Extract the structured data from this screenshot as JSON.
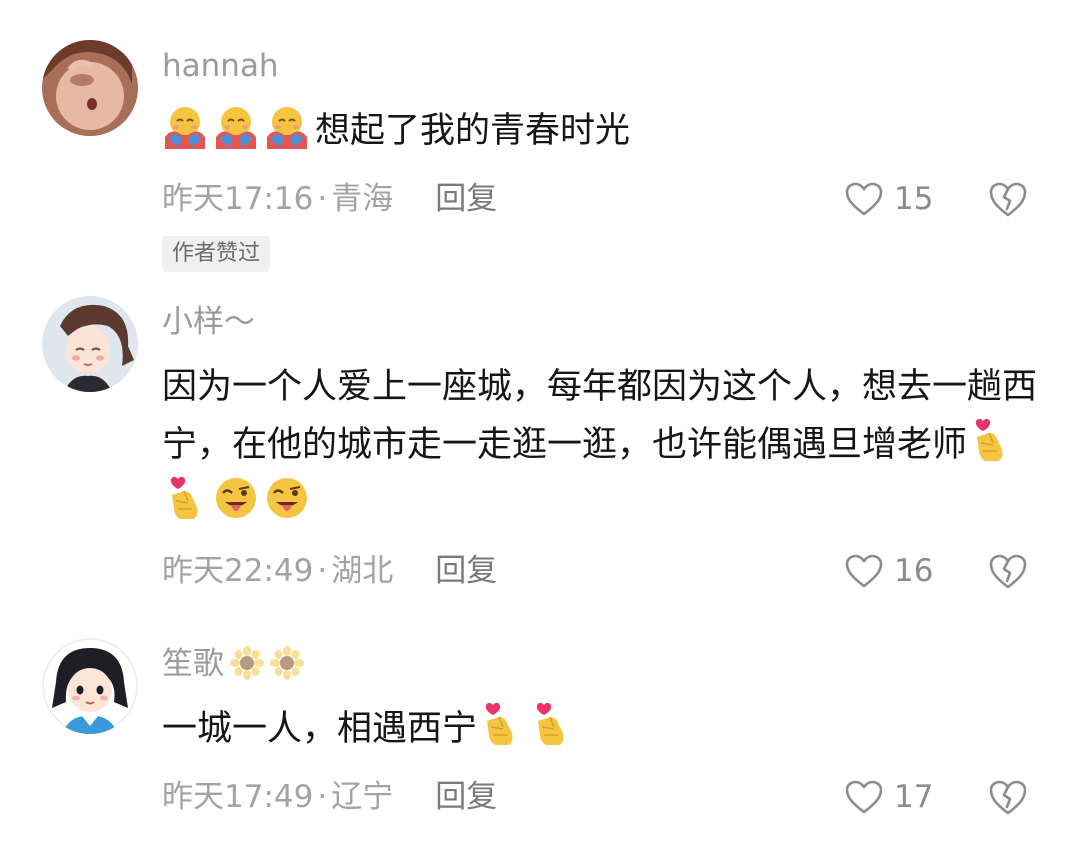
{
  "comments": [
    {
      "username": "hannah",
      "content": "想起了我的青春时光",
      "content_prefix_emojis": [
        "smiling-face-with-open-hands",
        "smiling-face-with-open-hands",
        "smiling-face-with-open-hands"
      ],
      "time": "昨天17:16",
      "separator": "·",
      "location": "青海",
      "reply_label": "回复",
      "likes": "15",
      "badge": "作者赞过"
    },
    {
      "username": "小样～",
      "content": "因为一个人爱上一座城，每年都因为这个人，想去一趟西宁，在他的城市走一走逛一逛，也许能偶遇旦增老师",
      "content_suffix_emojis": [
        "finger-heart",
        "finger-heart",
        "winking-face-with-tongue",
        "winking-face-with-tongue"
      ],
      "time": "昨天22:49",
      "separator": "·",
      "location": "湖北",
      "reply_label": "回复",
      "likes": "16"
    },
    {
      "username": "笙歌",
      "username_emojis": [
        "sunflower",
        "sunflower"
      ],
      "content": "一城一人，相遇西宁",
      "content_suffix_emojis": [
        "finger-heart",
        "finger-heart"
      ],
      "time": "昨天17:49",
      "separator": "·",
      "location": "辽宁",
      "reply_label": "回复",
      "likes": "17"
    }
  ],
  "colors": {
    "username": "#9b9b9b",
    "text": "#161616",
    "meta": "#a3a3a3",
    "badge_bg": "#f0f0f0"
  }
}
